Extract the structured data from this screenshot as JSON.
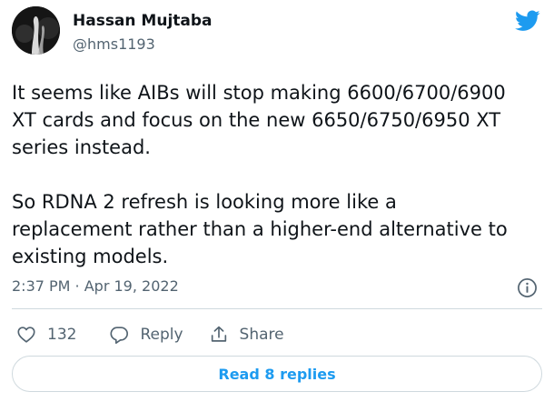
{
  "author": {
    "name": "Hassan Mujtaba",
    "handle": "@hms1193",
    "avatar": "avatar-icon"
  },
  "brand": {
    "icon": "twitter-bird-icon",
    "color": "#1d9bf0"
  },
  "tweet": {
    "lines": [
      "It seems like AIBs will stop making 6600/6700/6900",
      "XT cards and focus on the new 6650/6750/6950 XT",
      "series instead.",
      "So RDNA 2 refresh is looking more like a",
      "replacement rather than a higher-end alternative to",
      "existing models."
    ]
  },
  "meta": {
    "timestamp": "2:37 PM · Apr 19, 2022",
    "info_icon": "info-icon"
  },
  "actions": {
    "like_icon": "heart-icon",
    "like_count": "132",
    "reply_icon": "reply-bubble-icon",
    "reply_label": "Reply",
    "share_icon": "share-icon",
    "share_label": "Share"
  },
  "footer": {
    "read_replies": "Read 8 replies"
  },
  "colors": {
    "text": "#0f1419",
    "secondary": "#536471",
    "border": "#cfd9de",
    "link": "#1d9bf0"
  }
}
